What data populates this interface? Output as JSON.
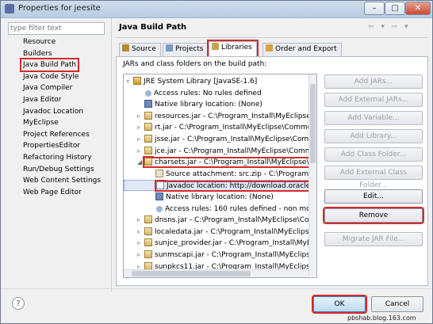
{
  "window": {
    "title": "Properties for jeesite",
    "controls": [
      "–",
      "□",
      "✕"
    ]
  },
  "filter": {
    "placeholder": "type filter text"
  },
  "nav": {
    "items": [
      "Resource",
      "Builders",
      "Java Build Path",
      "Java Code Style",
      "Java Compiler",
      "Java Editor",
      "Javadoc Location",
      "MyEclipse",
      "Project References",
      "PropertiesEditor",
      "Refactoring History",
      "Run/Debug Settings",
      "Web Content Settings",
      "Web Page Editor"
    ],
    "selected": "Java Build Path"
  },
  "page": {
    "title": "Java Build Path",
    "nav_arrows": "⇦ ▾ ⇨ ▾"
  },
  "tabs": [
    {
      "label": "Source",
      "color": "#b58a35"
    },
    {
      "label": "Projects",
      "color": "#7a98c4"
    },
    {
      "label": "Libraries",
      "color": "#c7a34a",
      "active": true
    },
    {
      "label": "Order and Export",
      "color": "#d9a33b"
    }
  ],
  "panel": {
    "label": "JARs and class folders on the build path:"
  },
  "tree": [
    {
      "text": "JRE System Library [JavaSE-1.6]",
      "icon": "lib",
      "toggle": "▿",
      "indent": 0
    },
    {
      "text": "Access rules: No rules defined",
      "icon": "key",
      "toggle": "",
      "indent": 1
    },
    {
      "text": "Native library location: (None)",
      "icon": "native",
      "toggle": "",
      "indent": 1
    },
    {
      "text": "resources.jar - C:\\Program_Install\\MyEclipse\\Cc",
      "icon": "jar",
      "toggle": "▹",
      "indent": 1
    },
    {
      "text": "rt.jar - C:\\Program_Install\\MyEclipse\\Common\\l",
      "icon": "jar",
      "toggle": "▹",
      "indent": 1
    },
    {
      "text": "jsse.jar - C:\\Program_Install\\MyEclipse\\Commo",
      "icon": "jar",
      "toggle": "▹",
      "indent": 1
    },
    {
      "text": "jce.jar - C:\\Program_Install\\MyEclipse\\Commo",
      "icon": "jar",
      "toggle": "▹",
      "indent": 1
    },
    {
      "text": "charsets.jar - C:\\Program_Install\\MyEclipse\\Con",
      "icon": "jar",
      "toggle": "◢",
      "indent": 1,
      "highlight": true
    },
    {
      "text": "Source attachment: src.zip - C:\\Program_Instal",
      "icon": "src",
      "toggle": "",
      "indent": 2
    },
    {
      "text": "Javadoc location: http://download.oracle.com",
      "icon": "doc",
      "toggle": "",
      "indent": 2,
      "selected": true,
      "highlight": true
    },
    {
      "text": "Native library location: (None)",
      "icon": "native",
      "toggle": "",
      "indent": 2
    },
    {
      "text": "Access rules: 160 rules defined - non modifi",
      "icon": "key",
      "toggle": "",
      "indent": 2
    },
    {
      "text": "dnsns.jar - C:\\Program_Install\\MyEclipse\\Comm",
      "icon": "jar",
      "toggle": "▹",
      "indent": 1
    },
    {
      "text": "localedata.jar - C:\\Program_Install\\MyEclipse\\C",
      "icon": "jar",
      "toggle": "▹",
      "indent": 1
    },
    {
      "text": "sunjce_provider.jar - C:\\Program_Install\\MyEclip",
      "icon": "jar",
      "toggle": "▹",
      "indent": 1
    },
    {
      "text": "sunmscapi.jar - C:\\Program_Install\\MyEclipse\\C",
      "icon": "jar",
      "toggle": "▹",
      "indent": 1
    },
    {
      "text": "sunpkcs11.jar - C:\\Program_Install\\MyEclipse\\C",
      "icon": "jar",
      "toggle": "▹",
      "indent": 1
    }
  ],
  "buttons": [
    {
      "label": "Add JARs...",
      "enabled": false
    },
    {
      "label": "Add External JARs...",
      "enabled": false
    },
    {
      "label": "Add Variable...",
      "enabled": false
    },
    {
      "label": "Add Library...",
      "enabled": false
    },
    {
      "label": "Add Class Folder...",
      "enabled": false
    },
    {
      "label": "Add External Class Folder...",
      "enabled": false
    },
    {
      "label": "Edit...",
      "enabled": true
    },
    {
      "label": "Remove",
      "enabled": true,
      "highlight": true
    },
    {
      "label": "Migrate JAR File...",
      "enabled": false
    }
  ],
  "footer": {
    "help": "?",
    "ok": "OK",
    "cancel": "Cancel"
  },
  "watermark": "pbshab.blog.163.com"
}
